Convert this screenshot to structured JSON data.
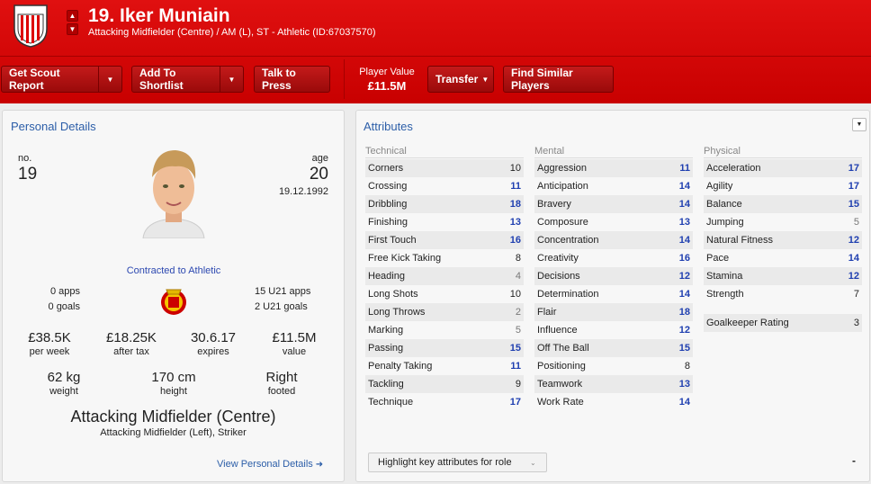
{
  "header": {
    "name": "19. Iker Muniain",
    "subtitle": "Attacking Midfielder (Centre) / AM (L), ST - Athletic (ID:67037570)",
    "up_icon": "chevron-up-icon",
    "down_icon": "chevron-down-icon",
    "crest_text": "ATHLETIC CLUB"
  },
  "toolbar": {
    "scout": "Get Scout Report",
    "shortlist": "Add To Shortlist",
    "press": "Talk to Press",
    "player_value_label": "Player Value",
    "player_value": "£11.5M",
    "transfer": "Transfer",
    "similar": "Find Similar Players"
  },
  "personal": {
    "title": "Personal Details",
    "no_label": "no.",
    "no": "19",
    "age_label": "age",
    "age": "20",
    "dob": "19.12.1992",
    "contract": "Contracted to Athletic",
    "apps": "0 apps",
    "goals": "0 goals",
    "u21_apps": "15 U21 apps",
    "u21_goals": "2 U21 goals",
    "wage": "£38.5K",
    "wage_label": "per week",
    "after_tax": "£18.25K",
    "after_tax_label": "after tax",
    "expires": "30.6.17",
    "expires_label": "expires",
    "value": "£11.5M",
    "value_label": "value",
    "weight": "62 kg",
    "weight_label": "weight",
    "height": "170 cm",
    "height_label": "height",
    "foot": "Right",
    "foot_label": "footed",
    "position": "Attacking Midfielder (Centre)",
    "positions_other": "Attacking Midfielder (Left), Striker",
    "view_link": "View Personal Details"
  },
  "attributes": {
    "title": "Attributes",
    "technical_label": "Technical",
    "mental_label": "Mental",
    "physical_label": "Physical",
    "technical": [
      [
        "Corners",
        10
      ],
      [
        "Crossing",
        11
      ],
      [
        "Dribbling",
        18
      ],
      [
        "Finishing",
        13
      ],
      [
        "First Touch",
        16
      ],
      [
        "Free Kick Taking",
        8
      ],
      [
        "Heading",
        4
      ],
      [
        "Long Shots",
        10
      ],
      [
        "Long Throws",
        2
      ],
      [
        "Marking",
        5
      ],
      [
        "Passing",
        15
      ],
      [
        "Penalty Taking",
        11
      ],
      [
        "Tackling",
        9
      ],
      [
        "Technique",
        17
      ]
    ],
    "mental": [
      [
        "Aggression",
        11
      ],
      [
        "Anticipation",
        14
      ],
      [
        "Bravery",
        14
      ],
      [
        "Composure",
        13
      ],
      [
        "Concentration",
        14
      ],
      [
        "Creativity",
        16
      ],
      [
        "Decisions",
        12
      ],
      [
        "Determination",
        14
      ],
      [
        "Flair",
        18
      ],
      [
        "Influence",
        12
      ],
      [
        "Off The Ball",
        15
      ],
      [
        "Positioning",
        8
      ],
      [
        "Teamwork",
        13
      ],
      [
        "Work Rate",
        14
      ]
    ],
    "physical": [
      [
        "Acceleration",
        17
      ],
      [
        "Agility",
        17
      ],
      [
        "Balance",
        15
      ],
      [
        "Jumping",
        5
      ],
      [
        "Natural Fitness",
        12
      ],
      [
        "Pace",
        14
      ],
      [
        "Stamina",
        12
      ],
      [
        "Strength",
        7
      ]
    ],
    "gk_label": "Goalkeeper Rating",
    "gk": "3",
    "highlight": "Highlight key attributes for role",
    "dash": "-"
  }
}
